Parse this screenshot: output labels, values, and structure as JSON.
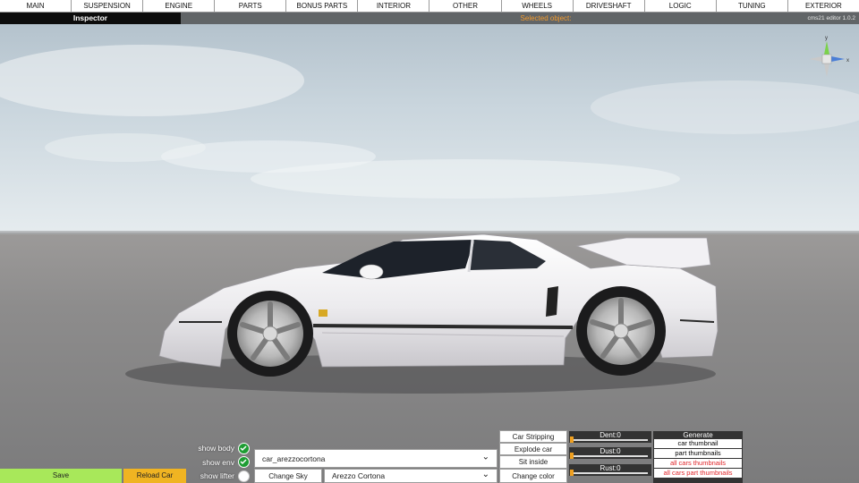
{
  "tabs": [
    "MAIN",
    "SUSPENSION",
    "ENGINE",
    "PARTS",
    "BONUS PARTS",
    "INTERIOR",
    "OTHER",
    "WHEELS",
    "DRIVESHAFT",
    "LOGIC",
    "TUNING",
    "EXTERIOR"
  ],
  "header": {
    "inspector": "Inspector",
    "selected_object": "Selected object:",
    "version": "cms21 editor 1.0.2"
  },
  "gizmo": {
    "y": "y",
    "x": "x",
    "z": "z"
  },
  "bottom": {
    "save": "Save",
    "reload": "Reload Car",
    "show_body": "show body",
    "show_env": "show env",
    "show_lifter": "show lifter",
    "show_body_checked": true,
    "show_env_checked": true,
    "show_lifter_checked": false,
    "car_select": "car_arezzocortona",
    "change_sky": "Change Sky",
    "car_name_select": "Arezzo Cortona",
    "actions": [
      "Car Stripping",
      "Explode car",
      "Sit inside",
      "Change color"
    ],
    "dent_label": "Dent:0",
    "dust_label": "Dust:0",
    "rust_label": "Rust:0",
    "dent_value": 0,
    "dust_value": 0,
    "rust_value": 0,
    "generate": {
      "title": "Generate",
      "buttons": [
        "car thumbnail",
        "part thumbnails",
        "all cars thumbnails",
        "all cars part thumbnails"
      ]
    }
  },
  "colors": {
    "save_bg": "#a8e85a",
    "reload_bg": "#f0b422",
    "selected_text": "#f29a2e",
    "check_on": "#1e9d33",
    "warning_text": "#e0262a",
    "car_body": "#ecebee"
  }
}
